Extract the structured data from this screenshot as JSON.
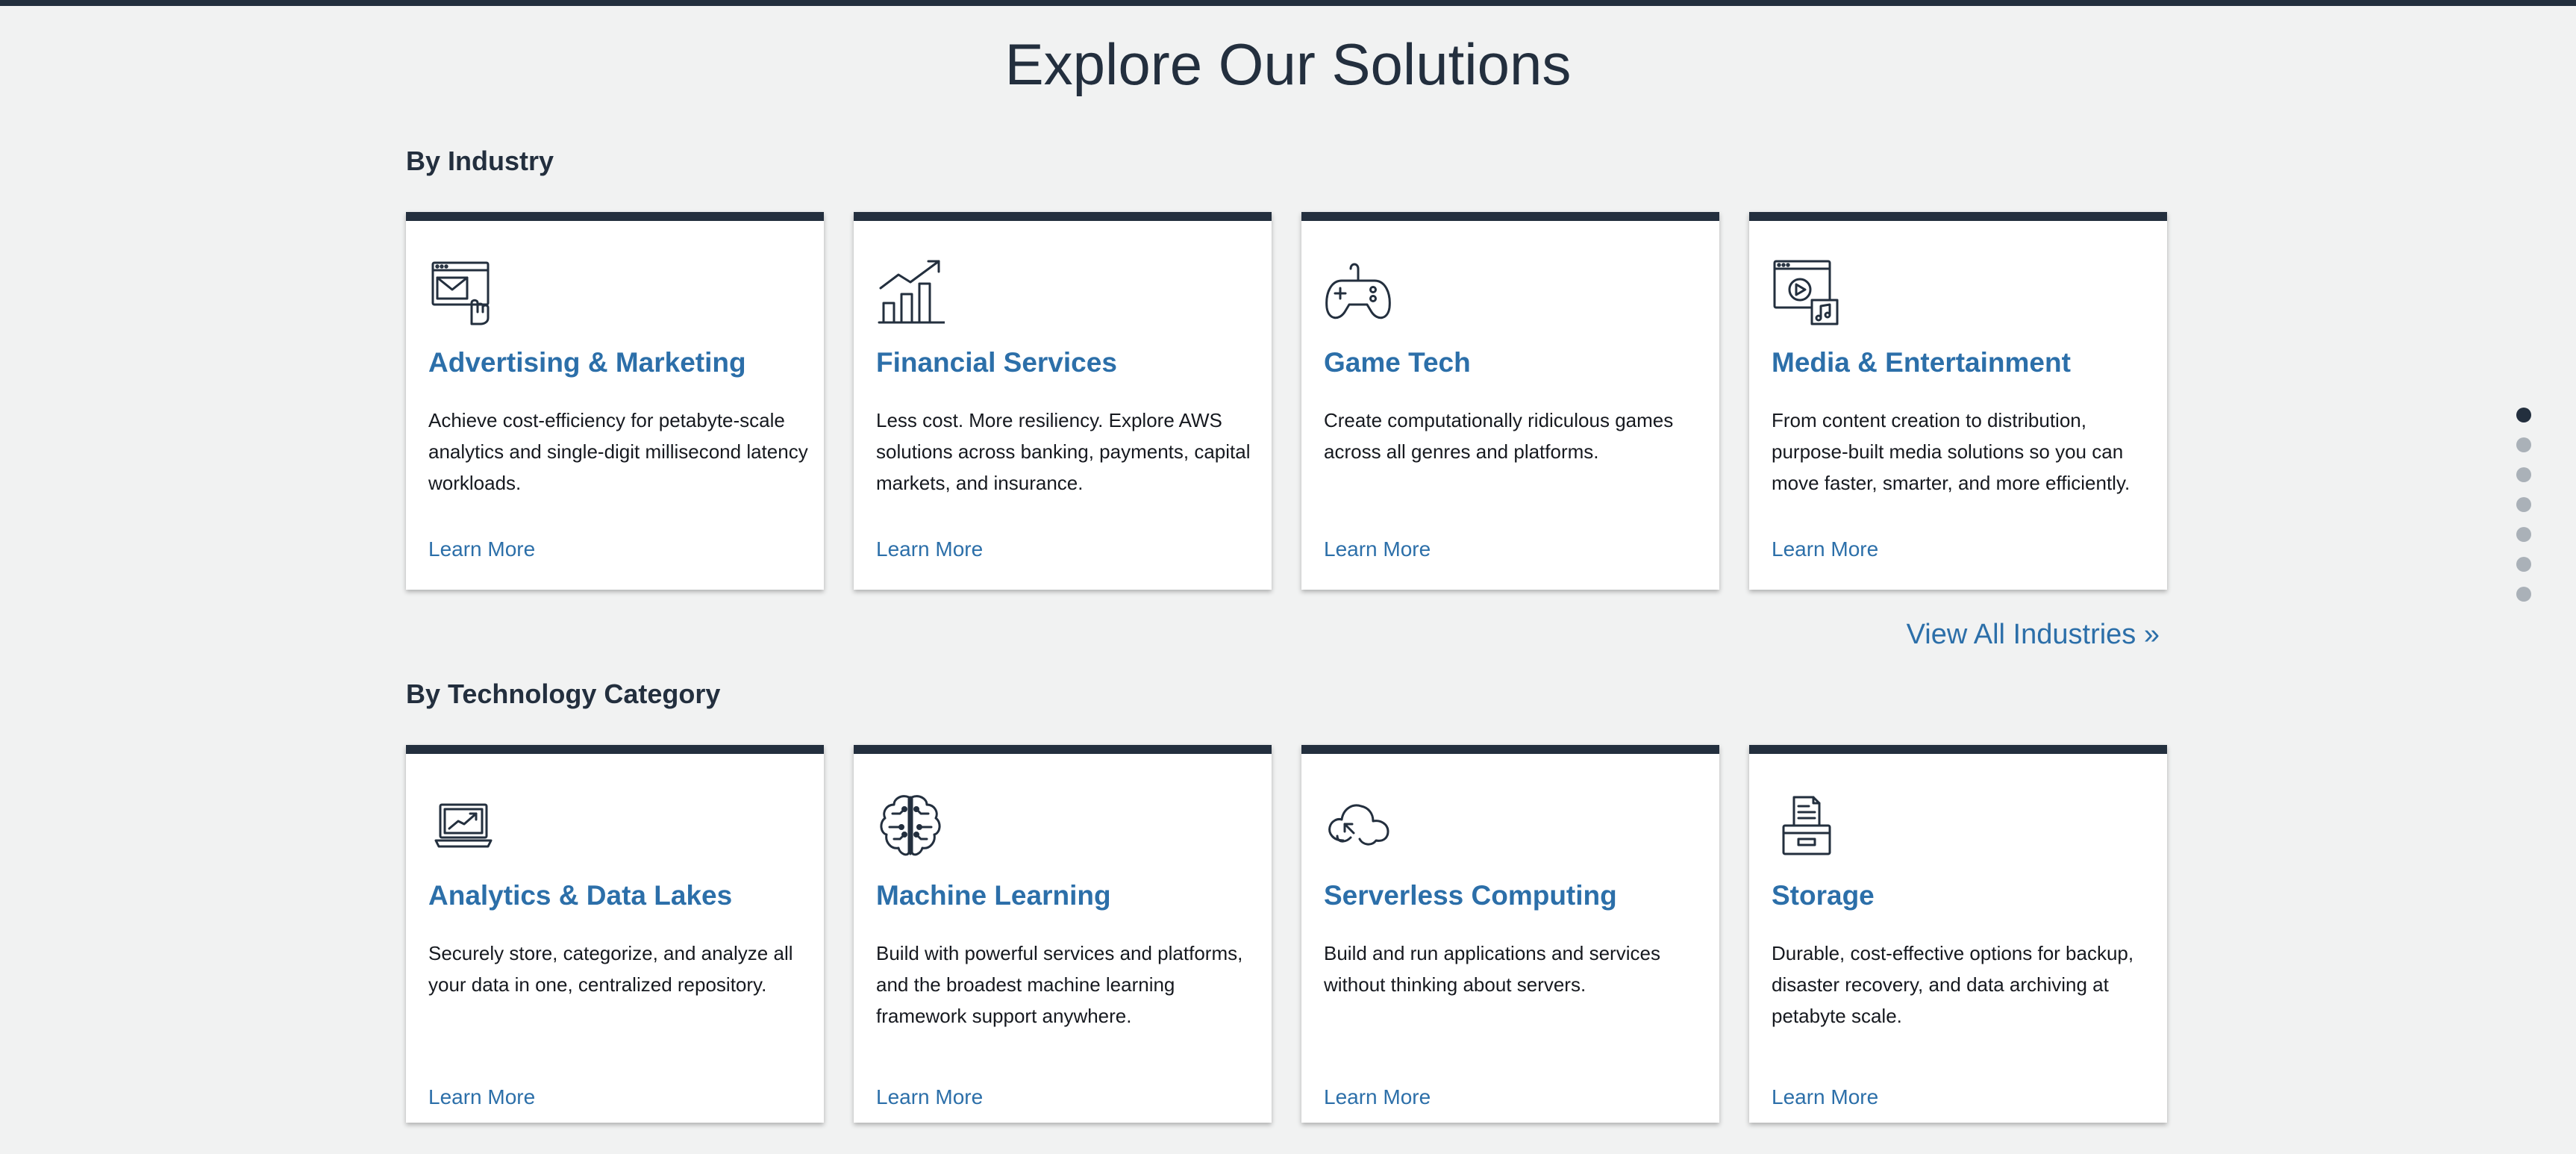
{
  "page": {
    "title": "Explore Our Solutions"
  },
  "industry": {
    "heading": "By Industry",
    "view_all": "View All Industries »",
    "cards": [
      {
        "icon": "advertising-marketing-icon",
        "title": "Advertising & Marketing",
        "description": "Achieve cost-efficiency for petabyte-scale analytics and single-digit millisecond latency workloads.",
        "link": "Learn More"
      },
      {
        "icon": "financial-services-icon",
        "title": "Financial Services",
        "description": "Less cost. More resiliency. Explore AWS solutions across banking, payments, capital markets, and insurance.",
        "link": "Learn More"
      },
      {
        "icon": "game-controller-icon",
        "title": "Game Tech",
        "description": "Create computationally ridiculous games across all genres and platforms.",
        "link": "Learn More"
      },
      {
        "icon": "media-player-icon",
        "title": "Media & Entertainment",
        "description": "From content creation to distribution, purpose-built media solutions so you can move faster, smarter, and more efficiently.",
        "link": "Learn More"
      }
    ]
  },
  "technology": {
    "heading": "By Technology Category",
    "cards": [
      {
        "icon": "laptop-chart-icon",
        "title": "Analytics & Data Lakes",
        "description": "Securely store, categorize, and analyze all your data in one, centralized repository.",
        "link": "Learn More"
      },
      {
        "icon": "brain-circuit-icon",
        "title": "Machine Learning",
        "description": "Build with powerful services and platforms, and the broadest machine learning framework support anywhere.",
        "link": "Learn More"
      },
      {
        "icon": "cloud-arrow-icon",
        "title": "Serverless Computing",
        "description": "Build and run applications and services without thinking about servers.",
        "link": "Learn More"
      },
      {
        "icon": "storage-file-icon",
        "title": "Storage",
        "description": "Durable, cost-effective options for backup, disaster recovery, and data archiving at petabyte scale.",
        "link": "Learn More"
      }
    ]
  },
  "pager": {
    "count": 7,
    "active_index": 0
  },
  "colors": {
    "dark": "#232f3e",
    "link": "#2c6fa9",
    "background": "#f1f2f2"
  }
}
